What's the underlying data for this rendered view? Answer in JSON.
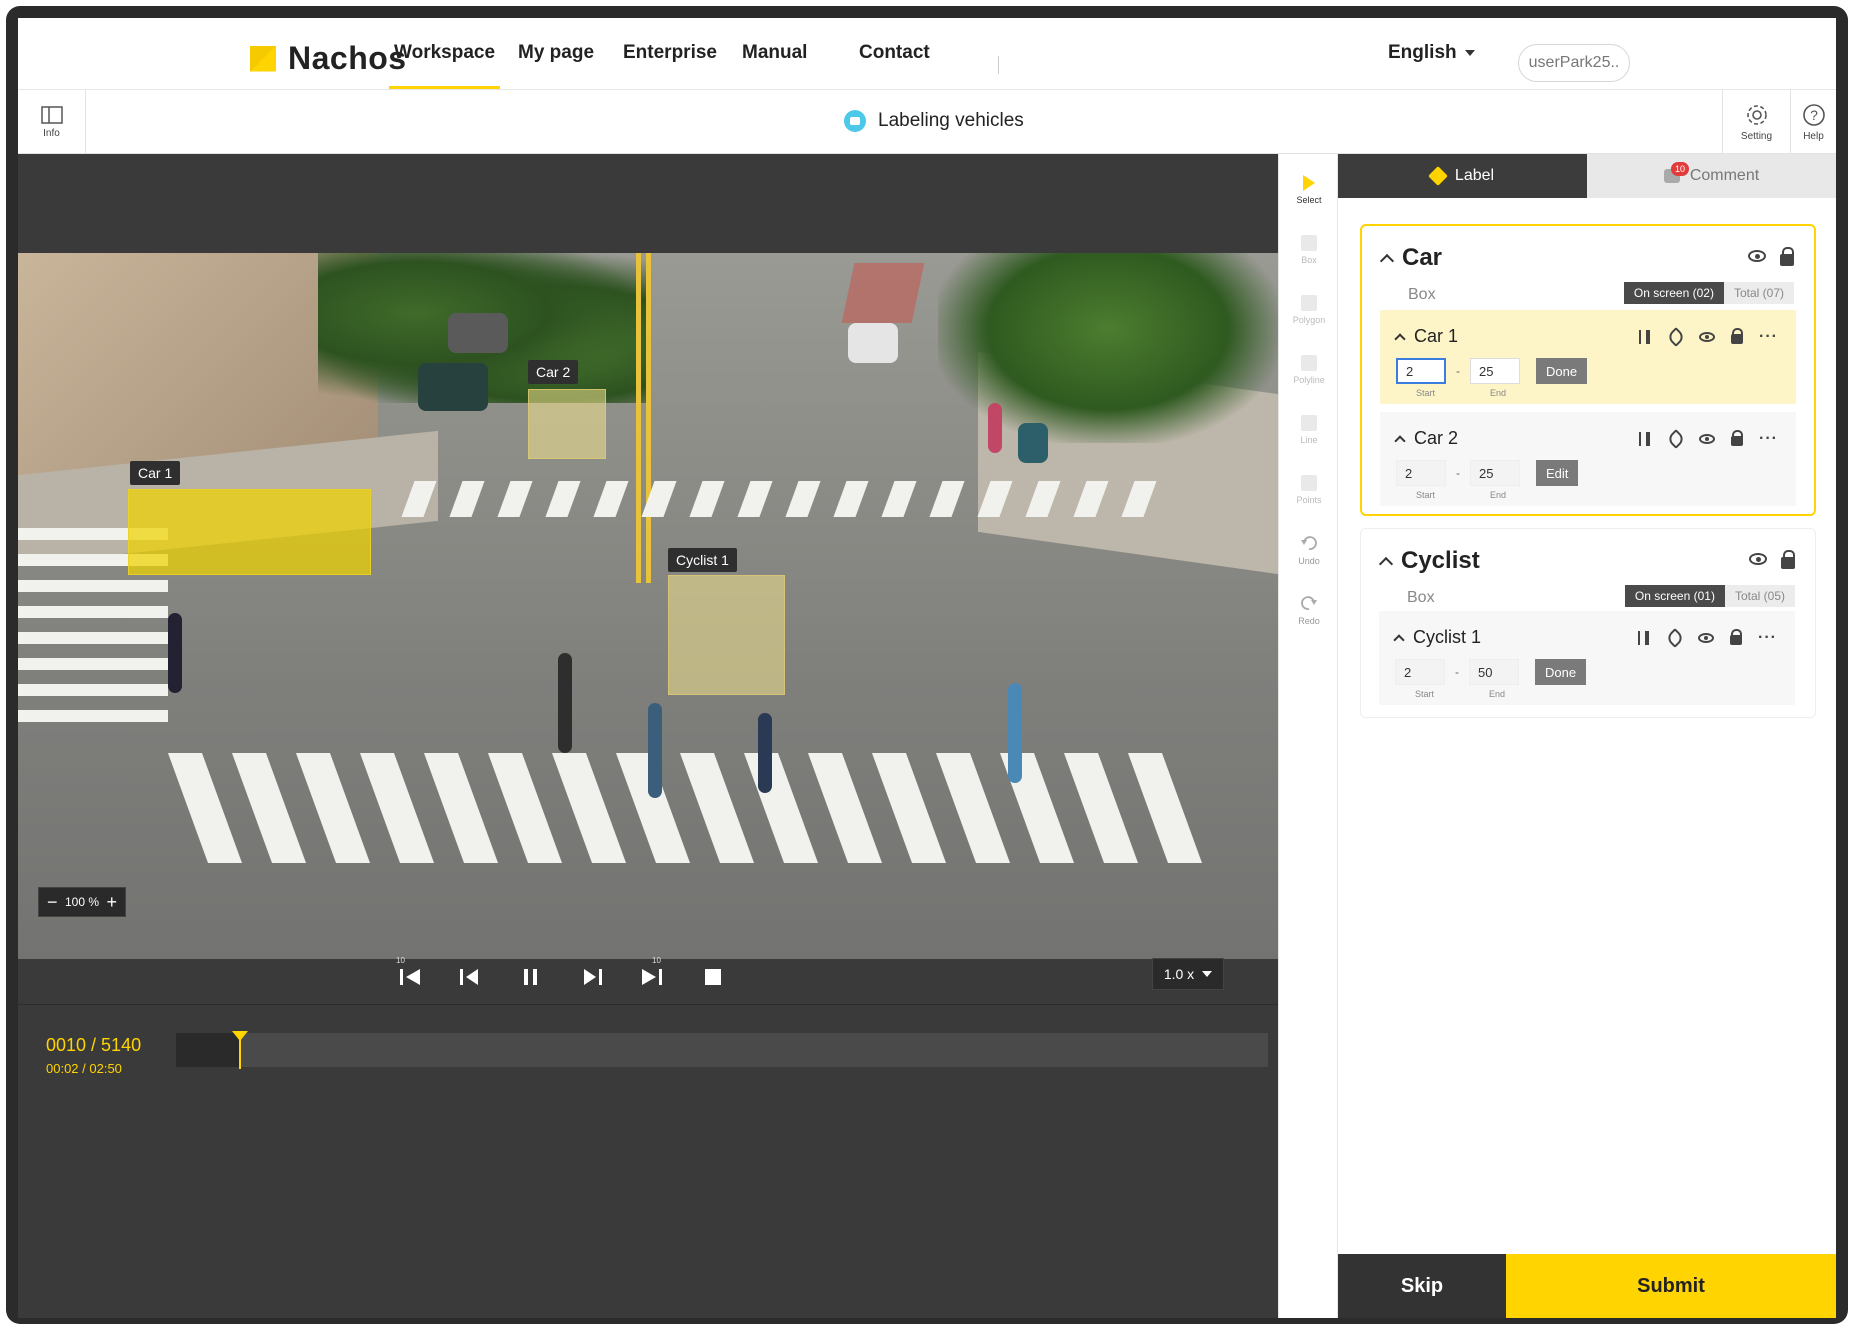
{
  "brand": {
    "name": "Nachos",
    "accent": "#ffd400"
  },
  "nav": {
    "items": [
      {
        "label": "Workspace",
        "active": true
      },
      {
        "label": "My page"
      },
      {
        "label": "Enterprise"
      },
      {
        "label": "Manual"
      },
      {
        "label": "Contact"
      }
    ],
    "language": "English",
    "user": "userPark25.."
  },
  "subbar": {
    "info_label": "Info",
    "title": "Labeling vehicles",
    "setting_label": "Setting",
    "help_label": "Help"
  },
  "canvas": {
    "boxes": [
      {
        "label": "Car 1",
        "style": "strong"
      },
      {
        "label": "Car 2",
        "style": "soft"
      },
      {
        "label": "Cyclist 1",
        "style": "soft"
      }
    ],
    "zoom": {
      "minus": "−",
      "value": "100 %",
      "plus": "+"
    },
    "speed": "1.0 x",
    "controls": {
      "skip_back_10": "10",
      "skip_fwd_10": "10"
    },
    "timeline": {
      "frame": "0010 / 5140",
      "time": "00:02 / 02:50",
      "progress": 0.0019
    }
  },
  "tools": [
    {
      "label": "Select",
      "active": true
    },
    {
      "label": "Box"
    },
    {
      "label": "Polygon"
    },
    {
      "label": "Polyline"
    },
    {
      "label": "Line"
    },
    {
      "label": "Points"
    },
    {
      "label": "Undo"
    },
    {
      "label": "Redo"
    }
  ],
  "panel": {
    "tabs": {
      "label": "Label",
      "comment": "Comment",
      "comment_badge": "10"
    },
    "groups": [
      {
        "name": "Car",
        "type": "Box",
        "on_screen": "On screen (02)",
        "total": "Total (07)",
        "items": [
          {
            "name": "Car 1",
            "start": "2",
            "end": "25",
            "action": "Done",
            "start_label": "Start",
            "end_label": "End"
          },
          {
            "name": "Car 2",
            "start": "2",
            "end": "25",
            "action": "Edit",
            "start_label": "Start",
            "end_label": "End"
          }
        ]
      },
      {
        "name": "Cyclist",
        "type": "Box",
        "on_screen": "On screen (01)",
        "total": "Total (05)",
        "items": [
          {
            "name": "Cyclist 1",
            "start": "2",
            "end": "50",
            "action": "Done",
            "start_label": "Start",
            "end_label": "End"
          }
        ]
      }
    ],
    "skip": "Skip",
    "submit": "Submit"
  }
}
